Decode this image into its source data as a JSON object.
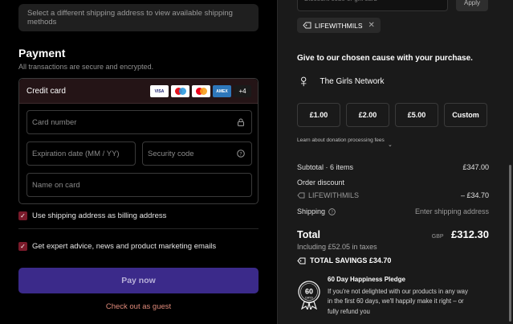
{
  "shipping_notice": "Select a different shipping address to view available shipping methods",
  "payment": {
    "title": "Payment",
    "subtitle": "All transactions are secure and encrypted.",
    "method_label": "Credit card",
    "card_brands": [
      "VISA",
      "Maestro",
      "Mastercard",
      "AMEX"
    ],
    "more_cards": "+4",
    "fields": {
      "card_number": "Card number",
      "expiration": "Expiration date (MM / YY)",
      "security_code": "Security code",
      "name_on_card": "Name on card"
    },
    "billing_checkbox": "Use shipping address as billing address",
    "marketing_checkbox": "Get expert advice, news and product marketing emails",
    "pay_button": "Pay now",
    "guest_link": "Check out as guest"
  },
  "summary": {
    "gift_placeholder": "Discount code or gift card",
    "apply_label": "Apply",
    "applied_code": "LIFEWITHMILS",
    "cause_title": "Give to our chosen cause with your purchase.",
    "cause_org": "The Girls Network",
    "donations": [
      "£1.00",
      "£2.00",
      "£5.00",
      "Custom"
    ],
    "learn_more": "Learn about donation processing fees",
    "subtotal_label": "Subtotal · 6 items",
    "subtotal_value": "£347.00",
    "order_discount_label": "Order discount",
    "discount_code": "LIFEWITHMILS",
    "discount_value": "– £34.70",
    "shipping_label": "Shipping",
    "shipping_value": "Enter shipping address",
    "total_label": "Total",
    "total_currency": "GBP",
    "total_value": "£312.30",
    "tax_note": "Including £52.05 in taxes",
    "savings": "TOTAL SAVINGS  £34.70",
    "pledge_badge_number": "60",
    "pledge_badge_unit": "DAYS",
    "pledge_title": "60 Day Happiness Pledge",
    "pledge_text": "If you're not delighted with our products in any way in the first 60 days, we'll happily make it right – or fully refund you"
  },
  "colors": {
    "accent_checkbox": "#7a1a2a",
    "pay_button": "#3b2a8a",
    "guest_link": "#e08a7a"
  }
}
